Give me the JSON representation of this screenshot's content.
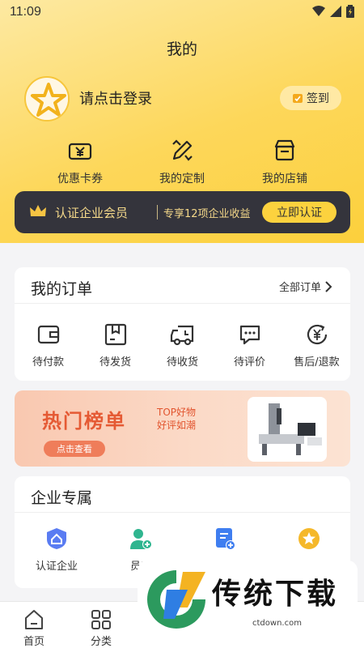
{
  "status_bar": {
    "time": "11:09"
  },
  "page": {
    "title": "我的"
  },
  "profile": {
    "login_prompt": "请点击登录",
    "signin_label": "签到"
  },
  "quick_actions": [
    {
      "label": "优惠卡券",
      "icon": "coupon-icon"
    },
    {
      "label": "我的定制",
      "icon": "customize-icon"
    },
    {
      "label": "我的店铺",
      "icon": "store-icon"
    }
  ],
  "membership": {
    "title": "认证企业会员",
    "benefit": "专享12项企业收益",
    "button": "立即认证",
    "accent": "#fcd23e"
  },
  "orders": {
    "title": "我的订单",
    "all_label": "全部订单",
    "items": [
      {
        "label": "待付款",
        "icon": "wallet-icon"
      },
      {
        "label": "待发货",
        "icon": "package-icon"
      },
      {
        "label": "待收货",
        "icon": "truck-icon"
      },
      {
        "label": "待评价",
        "icon": "comment-icon"
      },
      {
        "label": "售后/退款",
        "icon": "refund-icon"
      }
    ]
  },
  "banner": {
    "title": "热门榜单",
    "sub1": "TOP好物",
    "sub2": "好评如潮",
    "button": "点击查看"
  },
  "enterprise": {
    "title": "企业专属",
    "items": [
      {
        "label": "认证企业",
        "icon": "certify-enterprise-icon"
      },
      {
        "label": "员工",
        "icon": "staff-icon"
      },
      {
        "label": "",
        "icon": "document-add-icon"
      },
      {
        "label": "",
        "icon": "star-badge-icon"
      }
    ]
  },
  "tabs": [
    {
      "label": "首页",
      "icon": "home-icon"
    },
    {
      "label": "分类",
      "icon": "category-icon"
    }
  ],
  "watermark": {
    "text": "传统下载",
    "url": "ctdown.com"
  }
}
